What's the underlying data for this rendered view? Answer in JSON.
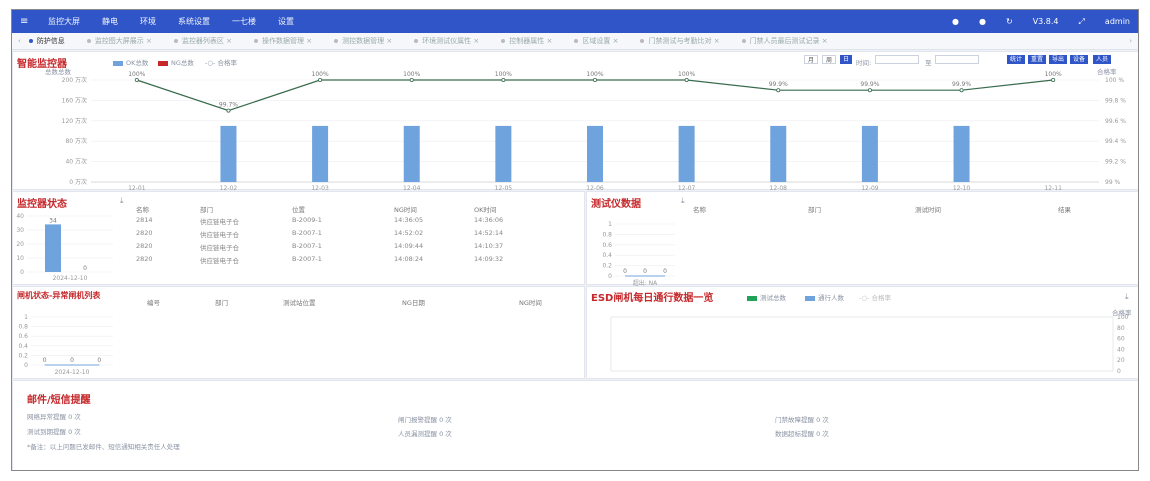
{
  "topbar": {
    "menu_icon": "menu-icon",
    "items": [
      "监控大屏",
      "静电",
      "环境",
      "系统设置",
      "一七楼",
      "设置"
    ],
    "version": "V3.8.4",
    "user": "admin"
  },
  "tabs": [
    {
      "label": "防护信息",
      "active": true
    },
    {
      "label": "监控图大屏展示"
    },
    {
      "label": "监控器列表区"
    },
    {
      "label": "操作数据管理"
    },
    {
      "label": "测控数据管理"
    },
    {
      "label": "环境测试仪属性"
    },
    {
      "label": "控制器属性"
    },
    {
      "label": "区域设置"
    },
    {
      "label": "门禁测试与考勤比对"
    },
    {
      "label": "门禁人员最后测试记录"
    }
  ],
  "top": {
    "title": "智能监控器",
    "legend": [
      "OK总数",
      "NG总数",
      "合格率"
    ],
    "left_axis": "总数总数",
    "right_axis": "合格率",
    "filters": [
      "月",
      "周",
      "日"
    ],
    "time_label": "时间:",
    "to": "至",
    "tools": [
      "统计",
      "重置",
      "导出",
      "设备",
      "人员"
    ],
    "chart_data": {
      "type": "bar",
      "categories": [
        "12-01",
        "12-02",
        "12-03",
        "12-04",
        "12-05",
        "12-06",
        "12-07",
        "12-08",
        "12-09",
        "12-10",
        "12-11"
      ],
      "yticks": [
        "0 万次",
        "40 万次",
        "80 万次",
        "120 万次",
        "160 万次",
        "200 万次"
      ],
      "y2ticks": [
        "99 %",
        "99.2 %",
        "99.4 %",
        "99.6 %",
        "99.8 %",
        "100 %"
      ],
      "ok": [
        0,
        110,
        110,
        110,
        110,
        110,
        110,
        110,
        110,
        110,
        0
      ],
      "rate": [
        100,
        99.7,
        100,
        100,
        100,
        100,
        100,
        99.9,
        99.9,
        99.9,
        100
      ],
      "rate_labels": [
        "100%",
        "99.7%",
        "100%",
        "100%",
        "100%",
        "100%",
        "100%",
        "99.9%",
        "99.9%",
        "99.9%",
        "100%"
      ],
      "colors": {
        "ok": "#6fa3dd",
        "ng": "#c6282b",
        "rate": "#3a6b4e"
      }
    }
  },
  "monitor": {
    "title": "监控器状态",
    "columns": [
      "名称",
      "部门",
      "位置",
      "NG时间",
      "OK时间"
    ],
    "rows": [
      [
        "2814",
        "供应链电子仓",
        "B-2009-1",
        "14:36:05",
        "14:36:06"
      ],
      [
        "2820",
        "供应链电子仓",
        "B-2007-1",
        "14:52:02",
        "14:52:14"
      ],
      [
        "2820",
        "供应链电子仓",
        "B-2007-1",
        "14:09:44",
        "14:10:37"
      ],
      [
        "2820",
        "供应链电子仓",
        "B-2007-1",
        "14:08:24",
        "14:09:32"
      ]
    ],
    "chart_data": {
      "type": "bar",
      "categories": [
        "2024-12-10"
      ],
      "values": [
        34,
        0
      ],
      "yticks": [
        "0",
        "10",
        "20",
        "30",
        "40"
      ]
    }
  },
  "tester": {
    "title": "测试仪数据",
    "columns": [
      "名称",
      "部门",
      "测试时间",
      "结果"
    ],
    "chart_data": {
      "type": "line",
      "values": [
        0,
        0,
        0
      ],
      "labels": [
        "0",
        "0",
        "0"
      ],
      "yticks": [
        "0",
        "0.2",
        "0.4",
        "0.6",
        "0.8",
        "1"
      ],
      "xlabel": "超出: NA"
    }
  },
  "gate": {
    "title": "闸机状态-异常闸机列表",
    "columns": [
      "编号",
      "部门",
      "测试站位置",
      "NG日期",
      "NG时间"
    ],
    "chart_data": {
      "type": "line",
      "values": [
        0,
        0,
        0
      ],
      "labels": [
        "0",
        "0",
        "0"
      ],
      "yticks": [
        "0",
        "0.2",
        "0.4",
        "0.6",
        "0.8",
        "1"
      ],
      "xlabel": "2024-12-10"
    }
  },
  "esd": {
    "title": "ESD闸机每日通行数据一览",
    "legend": [
      "测试总数",
      "通行人数",
      "合格率"
    ],
    "right_axis": "合格率",
    "y2ticks": [
      "0",
      "20",
      "40",
      "60",
      "80",
      "100"
    ]
  },
  "mail": {
    "title": "邮件/短信提醒",
    "items": [
      "网络异常提醒 0 次",
      "测试到期提醒 0 次",
      "闸门报警提醒 0 次",
      "人员漏测提醒 0 次",
      "门禁故障提醒 0 次",
      "数据超标提醒 0 次"
    ],
    "note": "*备注：以上问题已发邮件、短信通知相关责任人处理"
  }
}
